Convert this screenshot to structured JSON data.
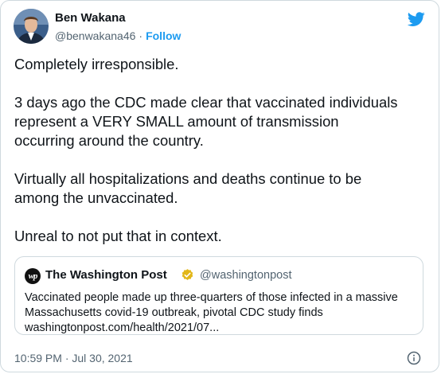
{
  "author": {
    "name": "Ben Wakana",
    "handle": "@benwakana46",
    "separator": "·",
    "follow_label": "Follow"
  },
  "tweet": {
    "paragraphs": [
      "Completely irresponsible.",
      "3 days ago the CDC made clear that vaccinated individuals\nrepresent a VERY SMALL amount of transmission\noccurring around the country.",
      "Virtually all hospitalizations and deaths continue to be\namong the unvaccinated.",
      "Unreal to not put that in context."
    ]
  },
  "quoted": {
    "logo_text": "wp",
    "name": "The Washington Post",
    "handle": "@washingtonpost",
    "text_lines": [
      "Vaccinated people made up three-quarters of those infected in a massive",
      "Massachusetts covid-19 outbreak, pivotal CDC study finds",
      "washingtonpost.com/health/2021/07..."
    ]
  },
  "meta": {
    "timestamp": "10:59 PM · Jul 30, 2021"
  },
  "icons": {
    "brand": "twitter-bird-icon",
    "verified": "verified-badge-icon",
    "info": "info-icon"
  },
  "colors": {
    "accent": "#1d9bf0",
    "verified_badge": "#e2b719",
    "muted_text": "#536471",
    "border": "#cfd9de"
  }
}
